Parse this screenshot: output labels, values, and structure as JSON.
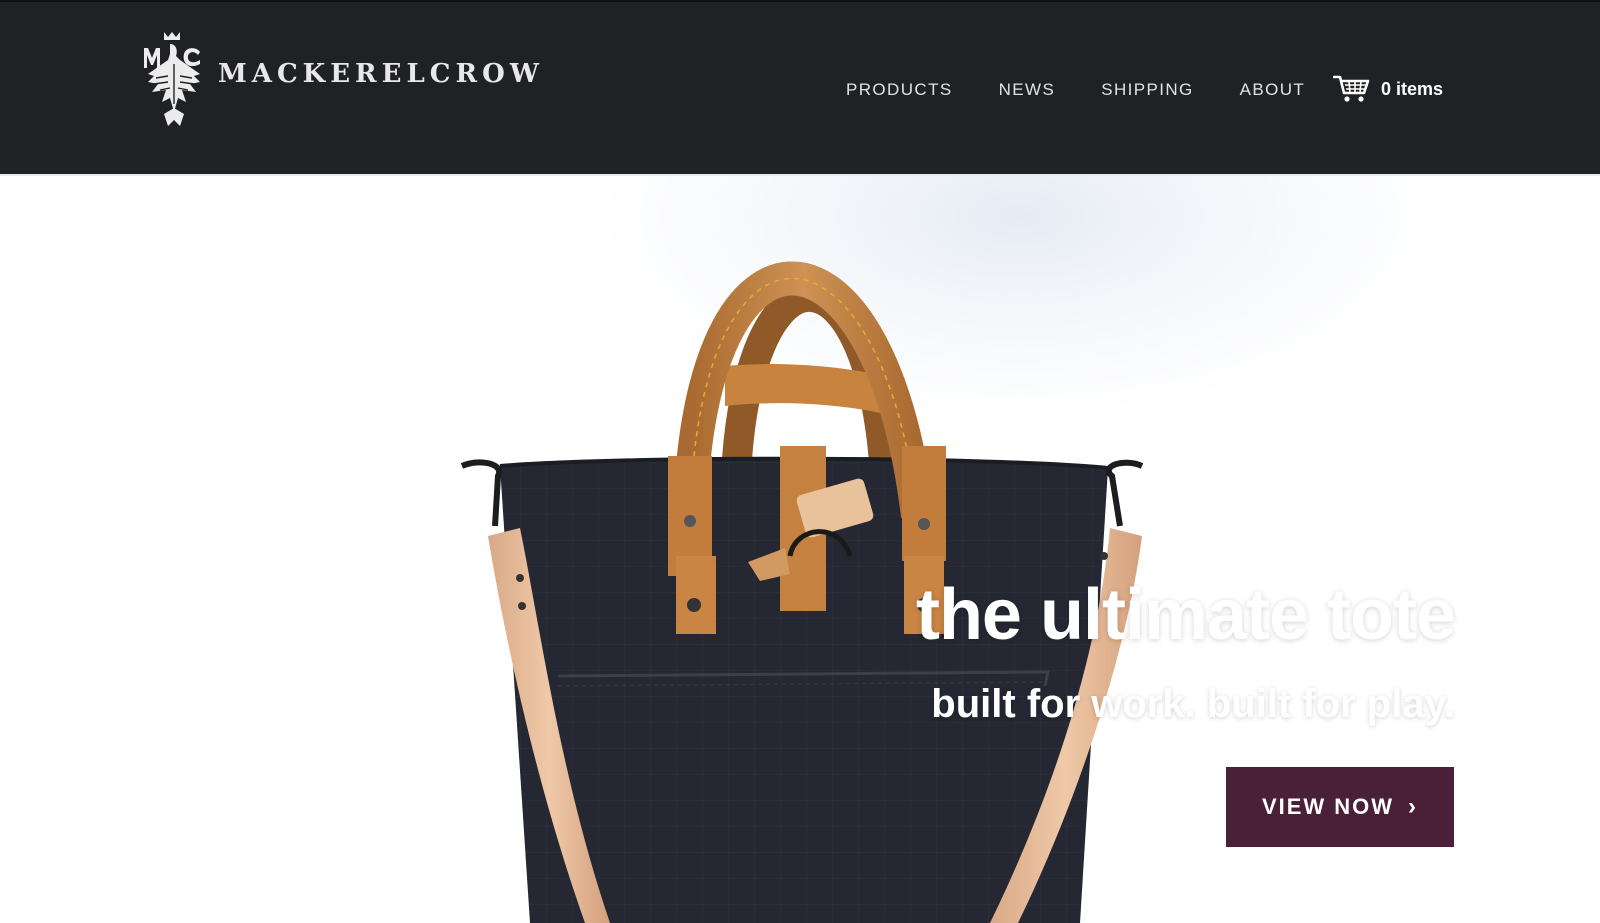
{
  "header": {
    "brand": "MACKERELCROW",
    "logo_icon": "mackerelcrow-crest-icon",
    "nav": [
      {
        "label": "PRODUCTS"
      },
      {
        "label": "NEWS"
      },
      {
        "label": "SHIPPING"
      },
      {
        "label": "ABOUT"
      }
    ],
    "cart": {
      "icon": "cart-icon",
      "count_label": "0 items"
    }
  },
  "hero": {
    "headline": "the ultimate tote",
    "subheadline": "built for work. built for play.",
    "cta_label": "VIEW NOW",
    "cta_icon": "chevron-right-icon"
  },
  "colors": {
    "header_bg": "#202125",
    "cta_bg": "#4a2038",
    "bag_canvas": "#23262e",
    "leather": "#c98a4a"
  }
}
